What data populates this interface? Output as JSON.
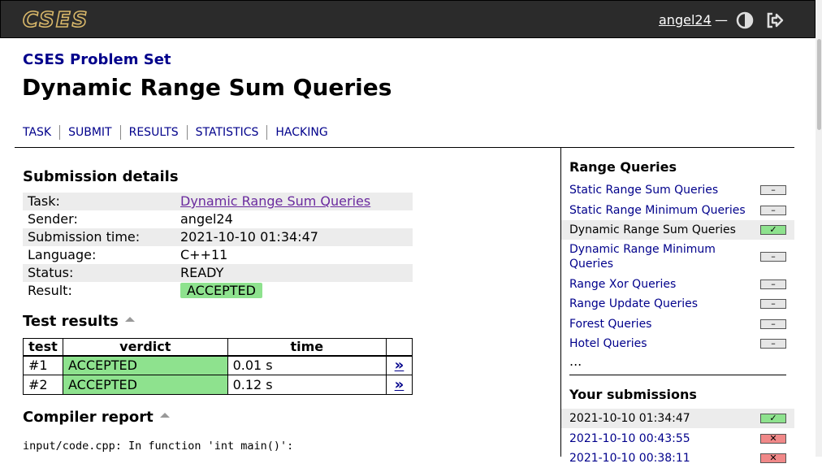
{
  "header": {
    "logo_text": "CSES",
    "username": "angel24",
    "separator": "—",
    "theme_icon": "half-circle-contrast-icon",
    "logout_icon": "logout-arrow-icon"
  },
  "site_title": "CSES Problem Set",
  "page_title": "Dynamic Range Sum Queries",
  "tabs": [
    "TASK",
    "SUBMIT",
    "RESULTS",
    "STATISTICS",
    "HACKING"
  ],
  "details": {
    "heading": "Submission details",
    "rows": [
      {
        "label": "Task:",
        "value": "Dynamic Range Sum Queries"
      },
      {
        "label": "Sender:",
        "value": "angel24"
      },
      {
        "label": "Submission time:",
        "value": "2021-10-10 01:34:47"
      },
      {
        "label": "Language:",
        "value": "C++11"
      },
      {
        "label": "Status:",
        "value": "READY"
      },
      {
        "label": "Result:",
        "value": "ACCEPTED"
      }
    ]
  },
  "test_results": {
    "heading": "Test results",
    "columns": [
      "test",
      "verdict",
      "time",
      ""
    ],
    "rows": [
      {
        "test": "#1",
        "verdict": "ACCEPTED",
        "time": "0.01 s",
        "link": "»"
      },
      {
        "test": "#2",
        "verdict": "ACCEPTED",
        "time": "0.12 s",
        "link": "»"
      }
    ]
  },
  "compiler": {
    "heading": "Compiler report",
    "line1": "input/code.cpp: In function 'int main()':"
  },
  "sidebar": {
    "heading": "Range Queries",
    "items": [
      {
        "label": "Static Range Sum Queries",
        "status": "–"
      },
      {
        "label": "Static Range Minimum Queries",
        "status": "–"
      },
      {
        "label": "Dynamic Range Sum Queries",
        "status": "✓"
      },
      {
        "label": "Dynamic Range Minimum Queries",
        "status": "–"
      },
      {
        "label": "Range Xor Queries",
        "status": "–"
      },
      {
        "label": "Range Update Queries",
        "status": "–"
      },
      {
        "label": "Forest Queries",
        "status": "–"
      },
      {
        "label": "Hotel Queries",
        "status": "–"
      }
    ],
    "more": "...",
    "subs_heading": "Your submissions",
    "submissions": [
      {
        "time": "2021-10-10 01:34:47",
        "status": "✓"
      },
      {
        "time": "2021-10-10 00:43:55",
        "status": "✕"
      },
      {
        "time": "2021-10-10 00:38:11",
        "status": "✕"
      }
    ]
  },
  "colors": {
    "accepted": "#8ee28e",
    "failed": "#f08888",
    "link": "#00008b",
    "topbar": "#2b2b2b"
  }
}
